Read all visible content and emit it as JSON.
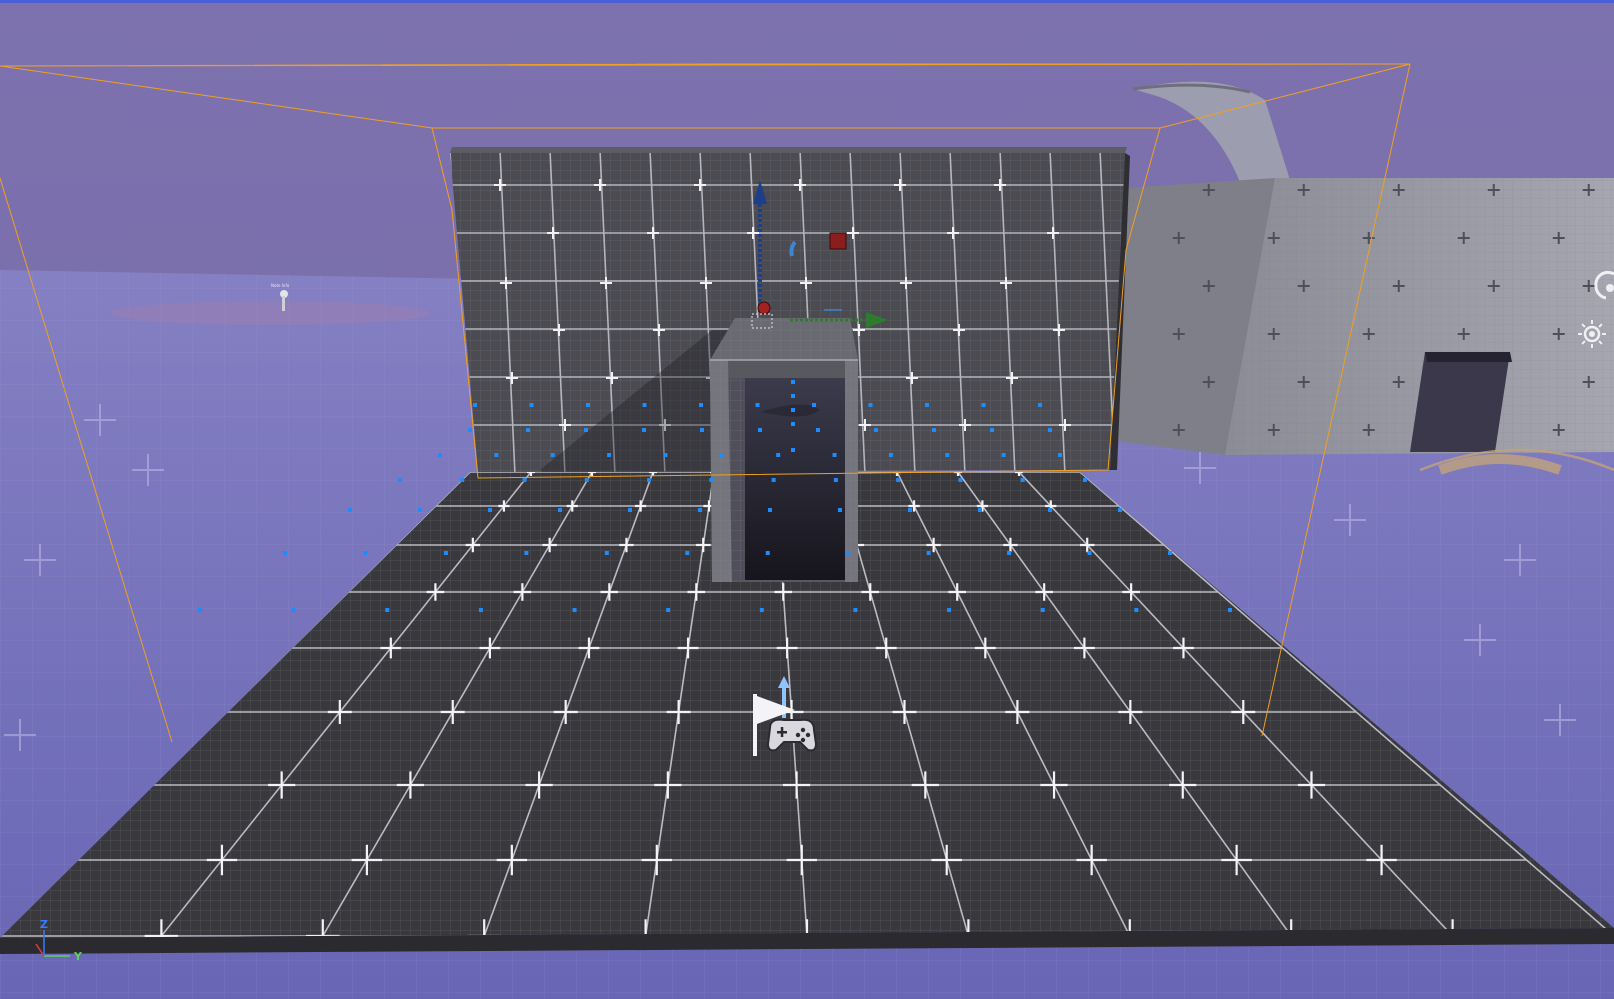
{
  "viewport": {
    "background_color": "#7a70ab",
    "ground_color": "#7070b6",
    "floor_color": "#3a3a3e",
    "wall_color": "#4a4a4f",
    "building_color": "#9a9aa4",
    "selection_color": "#f0a020",
    "probe_color": "#1e8cff"
  },
  "actors": {
    "far_note_label": "Note Info",
    "player_start_icon": "flag-gamepad-icon",
    "directional_light_icon": "sun-icon",
    "sky_light_icon": "light-bulb-icon"
  },
  "axis_indicator": {
    "z_label": "Z",
    "y_label": "Y",
    "z_color": "#3b7bff",
    "y_color": "#5bd15b"
  }
}
